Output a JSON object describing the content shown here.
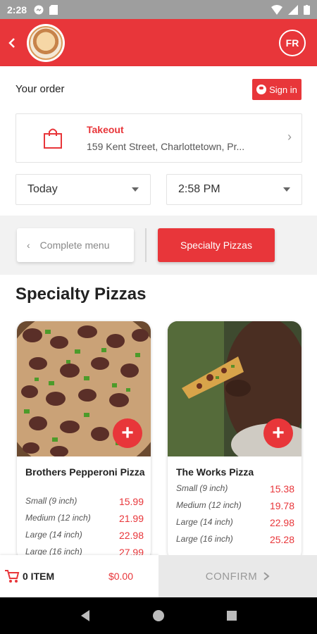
{
  "statusbar": {
    "time": "2:28"
  },
  "appbar": {
    "lang": "FR"
  },
  "order": {
    "title": "Your order",
    "signin": "Sign in",
    "takeout_label": "Takeout",
    "address": "159 Kent Street, Charlottetown, Pr...",
    "day": "Today",
    "time": "2:58 PM"
  },
  "menu_nav": {
    "complete_menu": "Complete menu",
    "current": "Specialty Pizzas"
  },
  "section_title": "Specialty Pizzas",
  "items": [
    {
      "name": "Brothers Pepperoni Pizza",
      "sizes": [
        {
          "label": "Small (9 inch)",
          "price": "15.99"
        },
        {
          "label": "Medium (12 inch)",
          "price": "21.99"
        },
        {
          "label": "Large (14 inch)",
          "price": "22.98"
        },
        {
          "label": "Large (16 inch)",
          "price": "27.99"
        }
      ]
    },
    {
      "name": "The Works Pizza",
      "sizes": [
        {
          "label": "Small (9 inch)",
          "price": "15.38"
        },
        {
          "label": "Medium (12 inch)",
          "price": "19.78"
        },
        {
          "label": "Large (14 inch)",
          "price": "22.98"
        },
        {
          "label": "Large (16 inch)",
          "price": "25.28"
        }
      ]
    }
  ],
  "cart": {
    "count": "0 ITEM",
    "total": "$0.00",
    "confirm": "CONFIRM"
  },
  "colors": {
    "accent": "#e8363a"
  }
}
